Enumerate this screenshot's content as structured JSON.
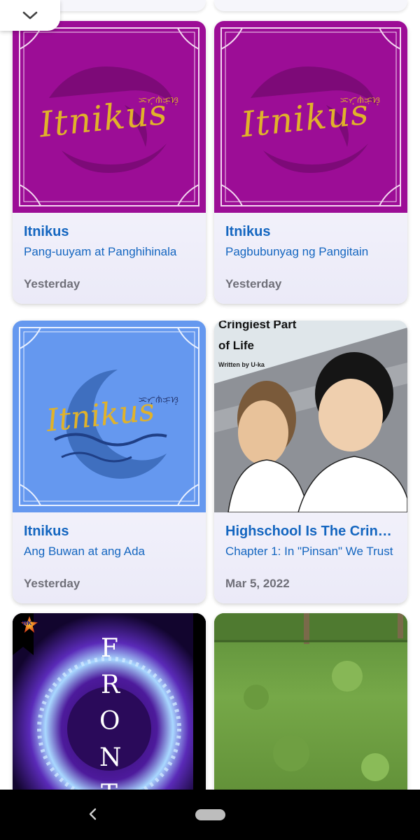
{
  "grid": {
    "cards": [
      {
        "title": "Itnikus",
        "subtitle": "Pang-uuyam at Panghihinala",
        "date": "Yesterday",
        "cover_logo": "Itnikus",
        "cover_script": "ᜁᜆ᜔ᜈᜒᜃᜓᜐ᜔",
        "cover_bg": "#9c0d96"
      },
      {
        "title": "Itnikus",
        "subtitle": "Pagbubunyag ng Pangitain",
        "date": "Yesterday",
        "cover_logo": "Itnikus",
        "cover_script": "ᜁᜆ᜔ᜈᜒᜃᜓᜐ᜔",
        "cover_bg": "#9c0d96"
      },
      {
        "title": "Itnikus",
        "subtitle": "Ang Buwan at ang Ada",
        "date": "Yesterday",
        "cover_logo": "Itnikus",
        "cover_script": "ᜁᜆ᜔ᜈᜒᜃᜓᜐ᜔",
        "cover_bg": "#6598ef"
      },
      {
        "title": "Highschool Is The Cringiest Part of Life",
        "subtitle": "Chapter 1: In \"Pinsan\" We Trust",
        "date": "Mar 5, 2022",
        "cover_title_line1": "Cringiest Part",
        "cover_title_line2": "of Life",
        "cover_author": "Written by U-ka"
      },
      {
        "cover_letters": [
          "F",
          "R",
          "O",
          "N",
          "T"
        ],
        "cover_badge": "WK"
      },
      {}
    ]
  },
  "colors": {
    "link_blue": "#1466c0",
    "date_gray": "#6f6f78"
  },
  "icons": {
    "collapse": "chevron-down-icon",
    "back": "back-arrow-icon",
    "home": "home-pill-icon"
  }
}
